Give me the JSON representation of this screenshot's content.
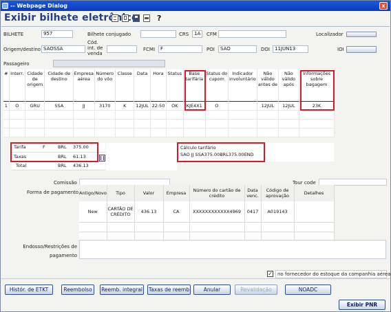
{
  "window": {
    "title": "-- Webpage Dialog",
    "close": "x"
  },
  "page": {
    "heading": "Exibir bilhete eletrônico"
  },
  "toolbar": {
    "icons": [
      "edit-icon",
      "copy-icon",
      "save-icon",
      "print-icon",
      "help-icon"
    ],
    "help_glyph": "?"
  },
  "form": {
    "bilhete_label": "BILHETE",
    "bilhete": "957",
    "bilhete_conj_label": "Bilhete conjugado",
    "bilhete_conj": "",
    "crs_label": "CRS",
    "crs": "1A",
    "cfm_label": "CFM",
    "cfm": "",
    "localizador_label": "Localizador",
    "origem_label": "Origem/destino",
    "origem": "SAOSSA",
    "cod_label": "Cód. int. de venda",
    "cod": "",
    "fcmi_label": "FCMI",
    "fcmi": "F",
    "poi_label": "POI",
    "poi": "SAO",
    "doi_label": "DOI",
    "doi": "11JUN13",
    "ioi_label": "IOI",
    "passageiro_label": "Passageiro",
    "passageiro": ""
  },
  "segments": {
    "columns": [
      "#",
      "Interr.",
      "Cidade de origem",
      "Cidade de destino",
      "Empresa aérea",
      "Número do vôo",
      "Classe",
      "Data",
      "Hora",
      "Status",
      "Base tarifária",
      "Status do cupom",
      "Indicador involuntário",
      "Não válido antes de",
      "Não válido após",
      "Informações sobre bagagem"
    ],
    "rows": [
      [
        "1",
        "O",
        "GRU",
        "SSA",
        "JJ",
        "3170",
        "K",
        "12JUL",
        "22:50",
        "OK",
        "KJE4X1",
        "O",
        "",
        "12JUL",
        "12JUL",
        "23K"
      ]
    ]
  },
  "fare": {
    "tarifa_label": "Tarifa",
    "tarifa_code": "F",
    "tarifa_cur": "BRL",
    "tarifa": "375.00",
    "taxas_label": "Taxas",
    "taxas_cur": "BRL",
    "taxas": "61.13",
    "total_label": "Total",
    "total_cur": "BRL",
    "total": "436.13",
    "calc_label": "Cálculo tarifário",
    "calc": "SAO JJ SSA375.00BRL375.00END"
  },
  "comissao_label": "Comissão",
  "tour_label": "Tour code",
  "forma_label": "Forma de pagamento",
  "payment": {
    "columns": [
      "Antigo/Novo",
      "Tipo",
      "Valor",
      "Empresa",
      "Número do cartão de crédito",
      "Data venc.",
      "Código de aprovação",
      "Detalhes"
    ],
    "rows": [
      [
        "New",
        "CARTÃO DE CRÉDITO",
        "436.13",
        "CA",
        "XXXXXXXXXXXX4969",
        "0417",
        "A019143",
        ""
      ]
    ]
  },
  "endosso_label": "Endosso/Restrições de pagamento",
  "checkbox": {
    "label": "no fornecedor do estoque da companhia aérea",
    "mark": "✓"
  },
  "buttons": {
    "historico": "Histór. de ETKT",
    "reembolso": "Reembolso",
    "reemb_integral": "Reemb. integral",
    "taxas_reemb": "Taxas de reemb",
    "anular": "Anular",
    "revalidacao": "Revalidação",
    "noadc": "NOADC",
    "exibir_pnr": "Exibir PNR"
  },
  "accent": "#d4192c"
}
